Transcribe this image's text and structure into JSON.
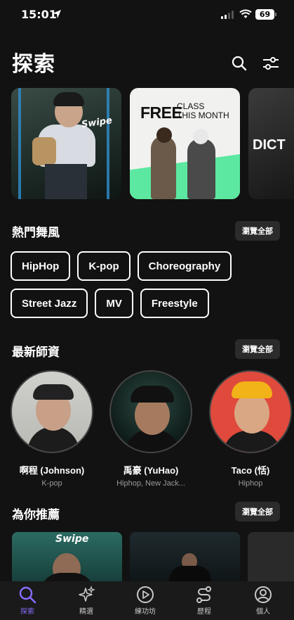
{
  "status_bar": {
    "time": "15:01",
    "battery": "69"
  },
  "header": {
    "title": "探索"
  },
  "banners": [
    {
      "overlay_text": "Swipe"
    },
    {
      "headline": "FREE",
      "subline_1": "CLASS",
      "subline_2": "THIS MONTH"
    },
    {
      "overlay_text": "DICT"
    }
  ],
  "styles_section": {
    "title": "熱門舞風",
    "browse_all": "瀏覽全部",
    "chips": [
      "HipHop",
      "K-pop",
      "Choreography",
      "Street Jazz",
      "MV",
      "Freestyle"
    ]
  },
  "teachers_section": {
    "title": "最新師資",
    "browse_all": "瀏覽全部",
    "teachers": [
      {
        "name": "啊程 (Johnson)",
        "styles": "K-pop"
      },
      {
        "name": "禹豪 (YuHao)",
        "styles": "Hiphop, New Jack..."
      },
      {
        "name": "Taco (恬)",
        "styles": "Hiphop"
      }
    ]
  },
  "recommend_section": {
    "title": "為你推薦",
    "browse_all": "瀏覽全部",
    "items": [
      {
        "overlay_text": "Swipe"
      }
    ]
  },
  "tab_bar": {
    "tabs": [
      {
        "label": "探索",
        "icon": "search-icon",
        "active": true
      },
      {
        "label": "精選",
        "icon": "sparkle-icon",
        "active": false
      },
      {
        "label": "練功坊",
        "icon": "play-circle-icon",
        "active": false
      },
      {
        "label": "歷程",
        "icon": "path-icon",
        "active": false
      },
      {
        "label": "個人",
        "icon": "person-icon",
        "active": false
      }
    ],
    "active_color": "#8a6cff"
  }
}
